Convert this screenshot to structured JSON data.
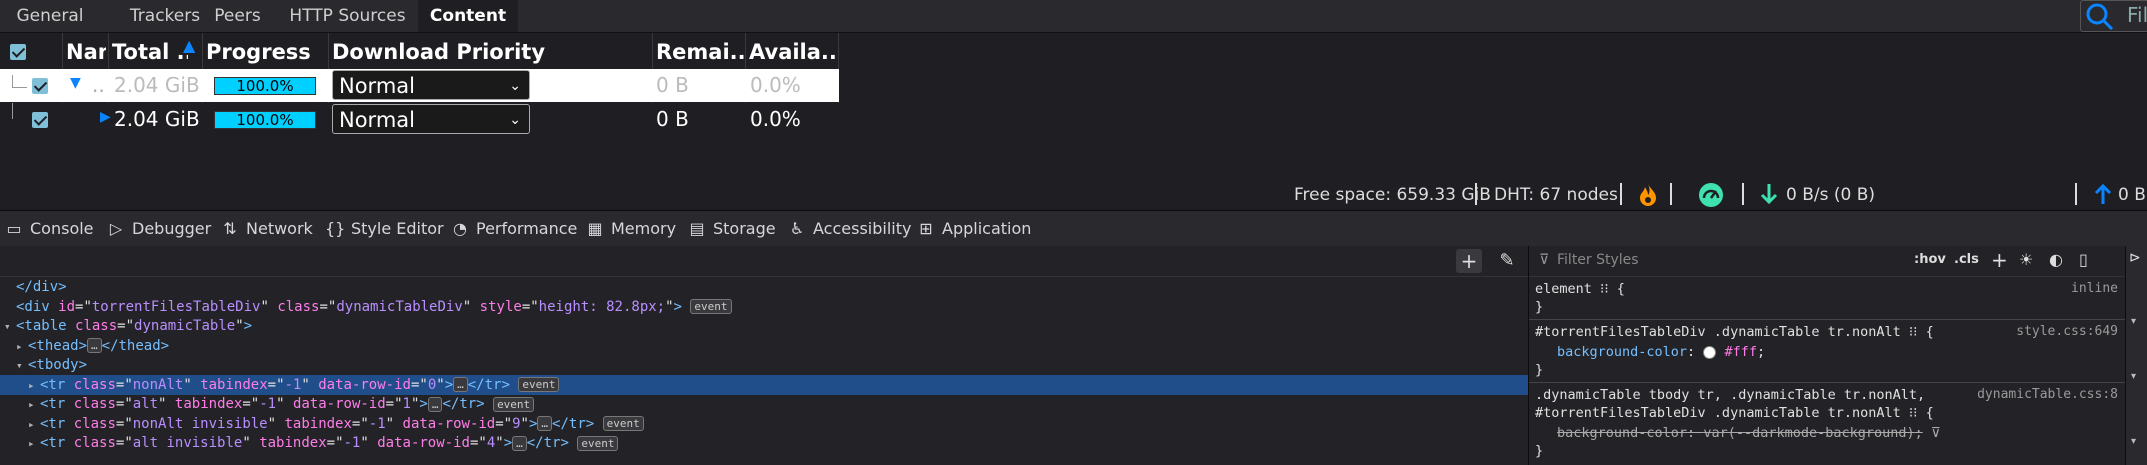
{
  "app": {
    "tabs": [
      "General",
      "Trackers",
      "Peers",
      "HTTP Sources",
      "Content"
    ],
    "active_tab": "Content",
    "filter_placeholder": "Fil",
    "table": {
      "headers": [
        "Nam",
        "Total ...",
        "Progress",
        "Download Priority",
        "Remai...",
        "Availa..."
      ],
      "sort_indicator": "▲",
      "rows": [
        {
          "name": "..",
          "total": "2.04 GiB",
          "progress": "100.0%",
          "priority": "Normal",
          "remaining": "0 B",
          "availability": "0.0%"
        },
        {
          "name": "",
          "total": "2.04 GiB",
          "progress": "100.0%",
          "priority": "Normal",
          "remaining": "0 B",
          "availability": "0.0%"
        }
      ]
    },
    "status": {
      "free_space": "Free space: 659.33 GiB",
      "dht": "DHT: 67 nodes",
      "download": "0 B/s (0 B)",
      "upload": "0 B"
    }
  },
  "devtools": {
    "tabs": [
      "Console",
      "Debugger",
      "Network",
      "Style Editor",
      "Performance",
      "Memory",
      "Storage",
      "Accessibility",
      "Application"
    ],
    "tree": [
      {
        "indent": 0,
        "text": "</div>"
      },
      {
        "indent": 0,
        "open": "div",
        "attrs": [
          [
            "id",
            "torrentFilesTableDiv"
          ],
          [
            "class",
            "dynamicTableDiv"
          ],
          [
            "style",
            "height: 82.8px;"
          ]
        ],
        "badge": "event"
      },
      {
        "indent": 0,
        "twisty": "▾",
        "open": "table",
        "attrs": [
          [
            "class",
            "dynamicTable"
          ]
        ]
      },
      {
        "indent": 1,
        "twisty": "▸",
        "open": "thead",
        "collapsed": true,
        "close": "thead"
      },
      {
        "indent": 1,
        "twisty": "▾",
        "open": "tbody",
        "attrs": []
      },
      {
        "indent": 2,
        "twisty": "▸",
        "open": "tr",
        "attrs": [
          [
            "class",
            "nonAlt"
          ],
          [
            "tabindex",
            "-1"
          ],
          [
            "data-row-id",
            "0"
          ]
        ],
        "collapsed": true,
        "close": "tr",
        "badge": "event",
        "selected": true
      },
      {
        "indent": 2,
        "twisty": "▸",
        "open": "tr",
        "attrs": [
          [
            "class",
            "alt"
          ],
          [
            "tabindex",
            "-1"
          ],
          [
            "data-row-id",
            "1"
          ]
        ],
        "collapsed": true,
        "close": "tr",
        "badge": "event"
      },
      {
        "indent": 2,
        "twisty": "▸",
        "open": "tr",
        "attrs": [
          [
            "class",
            "nonAlt invisible"
          ],
          [
            "tabindex",
            "-1"
          ],
          [
            "data-row-id",
            "9"
          ]
        ],
        "collapsed": true,
        "close": "tr",
        "badge": "event"
      },
      {
        "indent": 2,
        "twisty": "▸",
        "open": "tr",
        "attrs": [
          [
            "class",
            "alt invisible"
          ],
          [
            "tabindex",
            "-1"
          ],
          [
            "data-row-id",
            "4"
          ]
        ],
        "collapsed": true,
        "close": "tr",
        "badge": "event"
      }
    ],
    "rules": {
      "filter_placeholder": "Filter Styles",
      "hov": ":hov",
      "cls": ".cls",
      "blocks": [
        {
          "selector": "element",
          "source": "inline",
          "decls": []
        },
        {
          "selector": "#torrentFilesTableDiv .dynamicTable tr.nonAlt",
          "source": "style.css:649",
          "decls": [
            {
              "prop": "background-color",
              "value": "#fff",
              "swatch": "#ffffff"
            }
          ]
        },
        {
          "selector": ".dynamicTable tbody tr, .dynamicTable tr.nonAlt,",
          "selector2": "#torrentFilesTableDiv .dynamicTable tr.nonAlt",
          "source": "dynamicTable.css:8",
          "decls": [
            {
              "prop": "background-color",
              "value": "var(--darkmode-background)",
              "struck": true
            }
          ]
        }
      ]
    }
  },
  "colors": {
    "accent_blue": "#0a84ff",
    "progress_fill": "#00d0ff",
    "selection": "#204e8a",
    "green": "#3fe1b0",
    "orange": "#ff9400"
  }
}
